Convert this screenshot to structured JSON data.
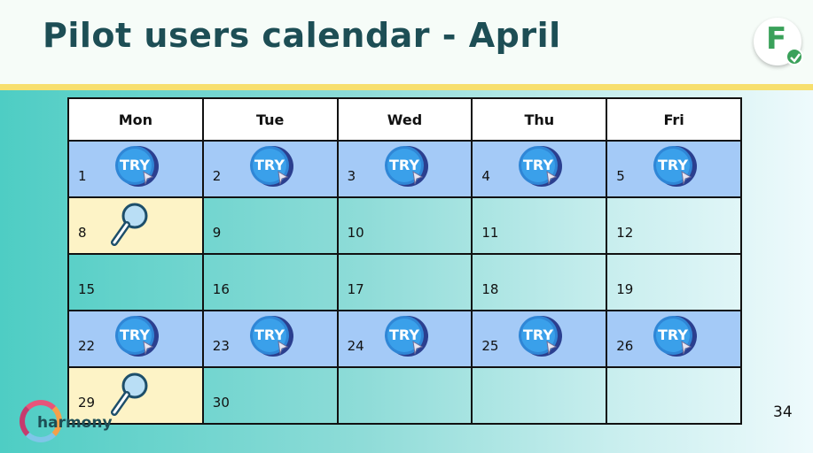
{
  "header": {
    "title": "Pilot users calendar - April"
  },
  "logo": {
    "letter": "F"
  },
  "calendar": {
    "weekdays": [
      "Mon",
      "Tue",
      "Wed",
      "Thu",
      "Fri"
    ],
    "weeks": [
      [
        {
          "day": "1",
          "icon": "try-icon",
          "style": "try-row"
        },
        {
          "day": "2",
          "icon": "try-icon",
          "style": "try-row"
        },
        {
          "day": "3",
          "icon": "try-icon",
          "style": "try-row"
        },
        {
          "day": "4",
          "icon": "try-icon",
          "style": "try-row"
        },
        {
          "day": "5",
          "icon": "try-icon",
          "style": "try-row"
        }
      ],
      [
        {
          "day": "8",
          "icon": "magnifier-icon",
          "style": "yellow"
        },
        {
          "day": "9",
          "icon": "",
          "style": "clear"
        },
        {
          "day": "10",
          "icon": "",
          "style": "clear"
        },
        {
          "day": "11",
          "icon": "",
          "style": "clear"
        },
        {
          "day": "12",
          "icon": "",
          "style": "clear"
        }
      ],
      [
        {
          "day": "15",
          "icon": "",
          "style": "clear"
        },
        {
          "day": "16",
          "icon": "",
          "style": "clear"
        },
        {
          "day": "17",
          "icon": "",
          "style": "clear"
        },
        {
          "day": "18",
          "icon": "",
          "style": "clear"
        },
        {
          "day": "19",
          "icon": "",
          "style": "clear"
        }
      ],
      [
        {
          "day": "22",
          "icon": "try-icon",
          "style": "try-row"
        },
        {
          "day": "23",
          "icon": "try-icon",
          "style": "try-row"
        },
        {
          "day": "24",
          "icon": "try-icon",
          "style": "try-row"
        },
        {
          "day": "25",
          "icon": "try-icon",
          "style": "try-row"
        },
        {
          "day": "26",
          "icon": "try-icon",
          "style": "try-row"
        }
      ],
      [
        {
          "day": "29",
          "icon": "magnifier-icon",
          "style": "yellow"
        },
        {
          "day": "30",
          "icon": "",
          "style": "clear"
        },
        {
          "day": "",
          "icon": "",
          "style": "clear"
        },
        {
          "day": "",
          "icon": "",
          "style": "clear"
        },
        {
          "day": "",
          "icon": "",
          "style": "clear"
        }
      ]
    ],
    "try_label": "TRY"
  },
  "footer": {
    "brand": "harmony",
    "page_number": "34"
  },
  "colors": {
    "title": "#1d4e55",
    "accent_yellow": "#f7df6e",
    "try_row": "#a4caf7",
    "highlight_cell": "#fdf3c6",
    "logo_green": "#3aa15a"
  }
}
